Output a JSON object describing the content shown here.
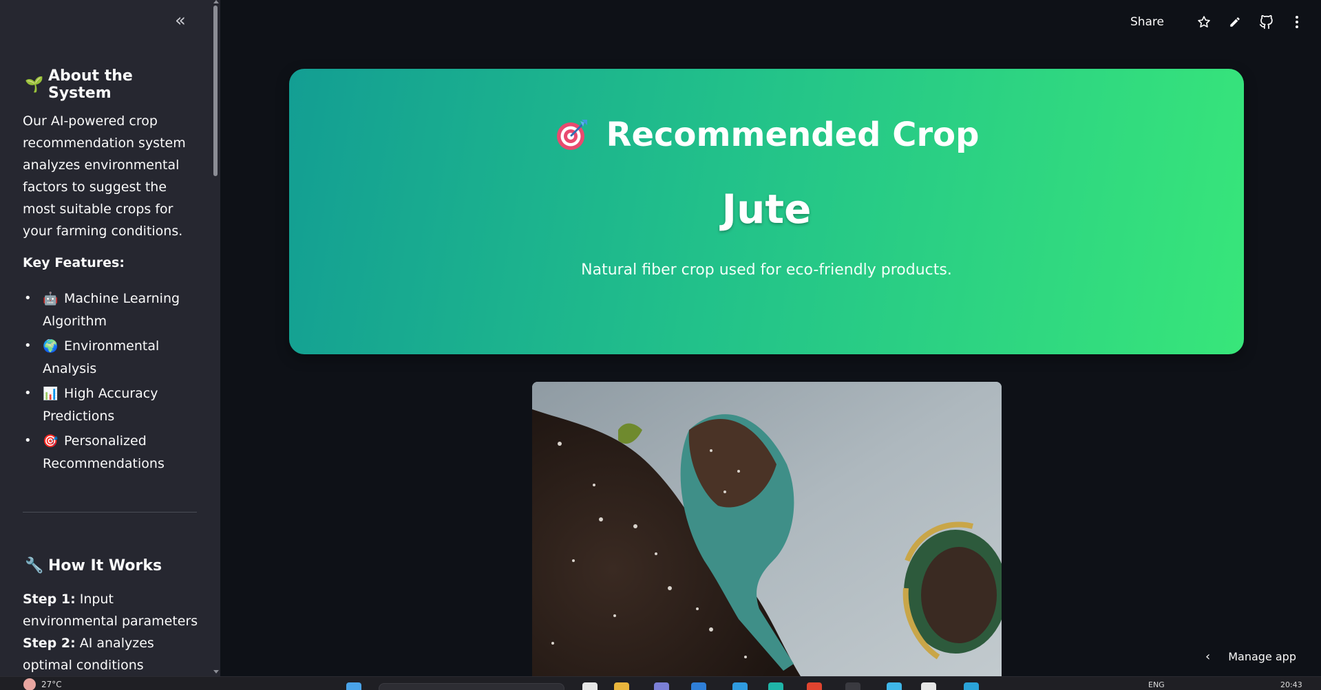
{
  "sidebar": {
    "about_title": "About the System",
    "about_emoji": "🌱",
    "about_text": "Our AI-powered crop recommendation system analyzes environmental factors to suggest the most suitable crops for your farming conditions.",
    "features_label": "Key Features:",
    "features": [
      {
        "emoji": "🤖",
        "label": "Machine Learning Algorithm"
      },
      {
        "emoji": "🌍",
        "label": "Environmental Analysis"
      },
      {
        "emoji": "📊",
        "label": "High Accuracy Predictions"
      },
      {
        "emoji": "🎯",
        "label": "Personalized Recommendations"
      }
    ],
    "how_title": "How It Works",
    "how_emoji": "🔧",
    "steps": [
      {
        "label": "Step 1:",
        "text": " Input environmental parameters"
      },
      {
        "label": "Step 2:",
        "text": " AI analyzes optimal conditions"
      }
    ]
  },
  "toolbar": {
    "share_label": "Share",
    "icons": [
      "star-icon",
      "pencil-icon",
      "github-icon",
      "more-vertical-icon"
    ]
  },
  "result": {
    "title": "Recommended Crop",
    "crop": "Jute",
    "description": "Natural fiber crop used for eco-friendly products."
  },
  "manage_app": "Manage app",
  "taskbar": {
    "temperature": "27°C",
    "language": "ENG",
    "time": "20:43"
  },
  "colors": {
    "background": "#0e1117",
    "sidebar": "#262730",
    "card_gradient_start": "#139e93",
    "card_gradient_end": "#38e67a"
  }
}
